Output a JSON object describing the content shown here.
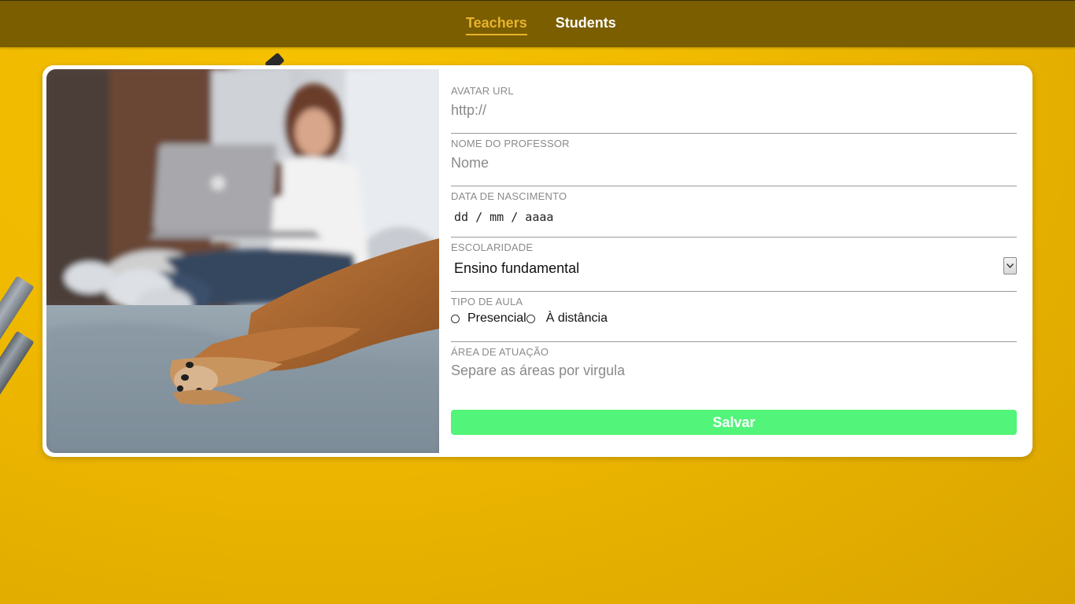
{
  "nav": {
    "items": [
      {
        "label": "Teachers",
        "active": true
      },
      {
        "label": "Students",
        "active": false
      }
    ],
    "accent_color": "#e8b32e",
    "bar_color": "#7a5e00"
  },
  "form": {
    "avatar": {
      "label": "AVATAR URL",
      "placeholder": "http://"
    },
    "name": {
      "label": "NOME DO PROFESSOR",
      "placeholder": "Nome"
    },
    "birthdate": {
      "label": "DATA DE NASCIMENTO",
      "placeholder": "dd / mm / aaaa"
    },
    "education": {
      "label": "ESCOLARIDADE",
      "selected": "Ensino fundamental"
    },
    "class_type": {
      "label": "TIPO DE AULA",
      "options": [
        "Presencial",
        "À distância"
      ]
    },
    "area": {
      "label": "ÁREA DE ATUAÇÃO",
      "placeholder": "Separe as áreas por virgula"
    },
    "save_label": "Salvar",
    "save_color": "#52f57a"
  },
  "icons": {
    "select_arrow": "chevron-down-icon",
    "photo": "woman-with-laptop-and-dog-photo"
  }
}
